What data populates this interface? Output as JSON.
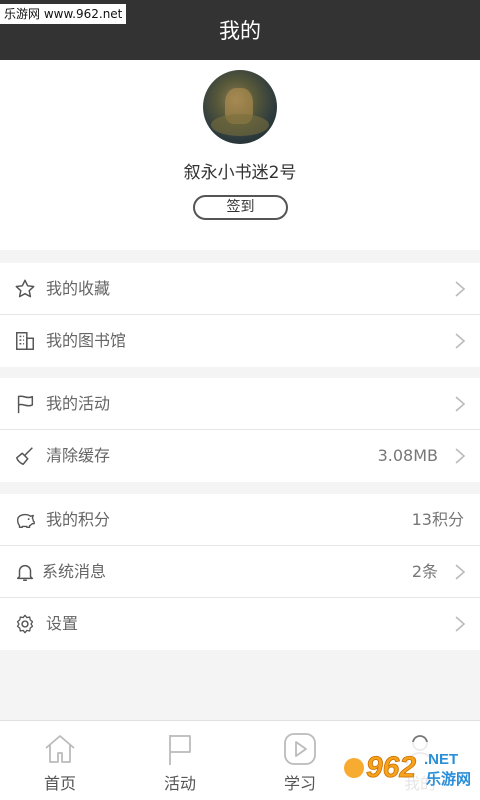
{
  "watermark": "乐游网 www.962.net",
  "header": {
    "title": "我的"
  },
  "profile": {
    "username": "叙永小书迷2号",
    "signin_label": "签到"
  },
  "menu": {
    "favorites": {
      "label": "我的收藏",
      "icon": "star-icon"
    },
    "library": {
      "label": "我的图书馆",
      "icon": "building-icon"
    },
    "activities": {
      "label": "我的活动",
      "icon": "flag-icon"
    },
    "cache": {
      "label": "清除缓存",
      "value": "3.08MB",
      "icon": "broom-icon"
    },
    "points": {
      "label": "我的积分",
      "value": "13积分",
      "icon": "piggy-bank-icon"
    },
    "messages": {
      "label": "系统消息",
      "value": "2条",
      "icon": "bell-icon"
    },
    "settings": {
      "label": "设置",
      "icon": "gear-icon"
    }
  },
  "tabs": {
    "home": {
      "label": "首页",
      "icon": "home-icon"
    },
    "activity": {
      "label": "活动",
      "icon": "flag-icon"
    },
    "study": {
      "label": "学习",
      "icon": "play-icon"
    },
    "mine": {
      "label": "我的",
      "icon": "user-icon"
    }
  },
  "overlay_logo": {
    "text": "962",
    "suffix": ".NET",
    "sub": "乐游网"
  },
  "colors": {
    "topbar": "#333333",
    "background": "#f4f4f4",
    "text": "#666666",
    "logo_orange": "#f7a21b"
  }
}
